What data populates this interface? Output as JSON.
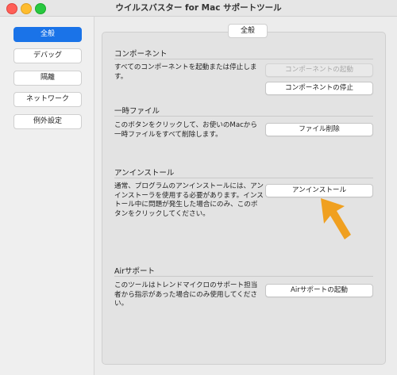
{
  "window": {
    "title": "ウイルスバスター for Mac サポートツール"
  },
  "sidebar": {
    "items": [
      {
        "label": "全般",
        "active": true
      },
      {
        "label": "デバッグ"
      },
      {
        "label": "隔離"
      },
      {
        "label": "ネットワーク"
      },
      {
        "label": "例外設定"
      }
    ]
  },
  "main": {
    "tab_label": "全般",
    "sections": [
      {
        "title": "コンポーネント",
        "description": "すべてのコンポーネントを起動または停止します。",
        "buttons": [
          {
            "label": "コンポーネントの起動",
            "enabled": false
          },
          {
            "label": "コンポーネントの停止",
            "enabled": true
          }
        ]
      },
      {
        "title": "一時ファイル",
        "description": "このボタンをクリックして、お使いのMacから一時ファイルをすべて削除します。",
        "buttons": [
          {
            "label": "ファイル削除",
            "enabled": true
          }
        ]
      },
      {
        "title": "アンインストール",
        "description": "通常、プログラムのアンインストールには、アンインストーラを使用する必要があります。インストール中に問題が発生した場合にのみ、このボタンをクリックしてください。",
        "buttons": [
          {
            "label": "アンインストール",
            "enabled": true
          }
        ]
      },
      {
        "title": "Airサポート",
        "description": "このツールはトレンドマイクロのサポート担当者から指示があった場合にのみ使用してください。",
        "buttons": [
          {
            "label": "Airサポートの起動",
            "enabled": true
          }
        ]
      }
    ]
  },
  "colors": {
    "accent": "#1a73e8",
    "arrow": "#f0a020"
  },
  "icons": {
    "pointer": "arrow-pointer-icon"
  }
}
